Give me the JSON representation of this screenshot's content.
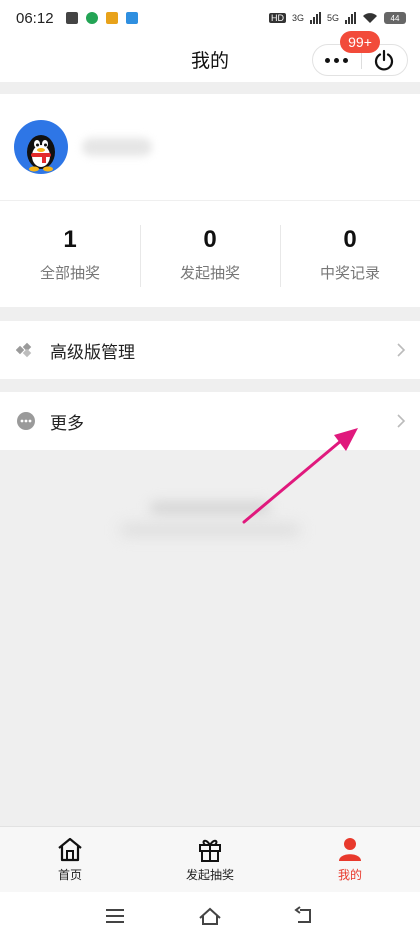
{
  "status_bar": {
    "time": "06:12",
    "network_label_1": "3G",
    "network_label_2": "5G",
    "battery": "44"
  },
  "nav": {
    "title": "我的",
    "badge": "99+"
  },
  "stats": [
    {
      "value": "1",
      "label": "全部抽奖"
    },
    {
      "value": "0",
      "label": "发起抽奖"
    },
    {
      "value": "0",
      "label": "中奖记录"
    }
  ],
  "menu": {
    "advanced": "高级版管理",
    "more": "更多"
  },
  "tabs": [
    {
      "label": "首页",
      "icon": "home-icon"
    },
    {
      "label": "发起抽奖",
      "icon": "gift-icon"
    },
    {
      "label": "我的",
      "icon": "person-icon",
      "active": true
    }
  ],
  "colors": {
    "accent": "#e8392c",
    "badge": "#f24b3a",
    "arrow": "#e0197d"
  }
}
